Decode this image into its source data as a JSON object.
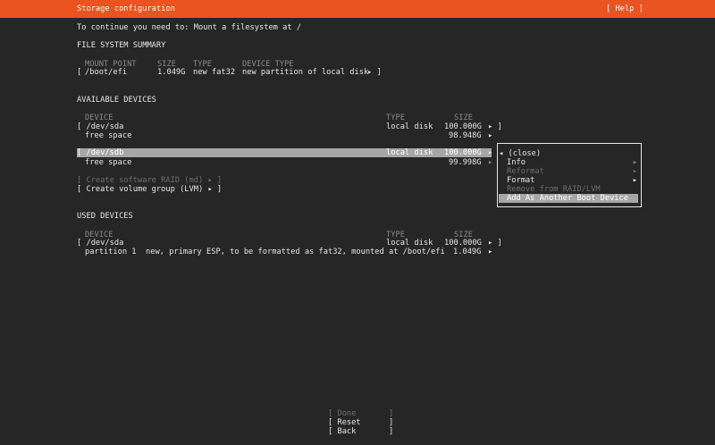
{
  "header": {
    "title": "Storage configuration",
    "help": "[ Help ]"
  },
  "prompt": "To continue you need to: Mount a filesystem at /",
  "fs_summary": {
    "heading": "FILE SYSTEM SUMMARY",
    "columns": [
      "MOUNT POINT",
      "SIZE",
      "TYPE",
      "DEVICE TYPE"
    ],
    "row": {
      "bracket": "[",
      "mount": "/boot/efi",
      "size": "1.049G",
      "type": "new fat32",
      "device_type": "new partition of local disk",
      "arrow": "▸ ]"
    }
  },
  "available": {
    "heading": "AVAILABLE DEVICES",
    "columns": {
      "device": "DEVICE",
      "type": "TYPE",
      "size": "SIZE"
    },
    "sda": {
      "name": "[ /dev/sda",
      "type": "local disk",
      "size": "100.000G",
      "arrow": "▸ ]",
      "free_label": "free space",
      "free_size": "98.948G",
      "free_arrow": "▸"
    },
    "sdb": {
      "name": "[ /dev/sdb",
      "type": "local disk",
      "size": "100.000G",
      "arrow": "▸",
      "free_label": "free space",
      "free_size": "99.998G",
      "free_arrow": "▸"
    },
    "raid": "[ Create software RAID (md) ▸ ]",
    "lvm": "[ Create volume group (LVM) ▸ ]"
  },
  "context_menu": {
    "close": "◂ (close)",
    "items": [
      {
        "label": "Info",
        "arrow": "▸",
        "enabled": true
      },
      {
        "label": "Reformat",
        "arrow": "▸",
        "enabled": false
      },
      {
        "label": "Format",
        "arrow": "▸",
        "enabled": true
      },
      {
        "label": "Remove from RAID/LVM",
        "arrow": "",
        "enabled": false
      },
      {
        "label": "Add As Another Boot Device",
        "arrow": "",
        "enabled": true,
        "selected": true
      }
    ]
  },
  "used": {
    "heading": "USED DEVICES",
    "columns": {
      "device": "DEVICE",
      "type": "TYPE",
      "size": "SIZE"
    },
    "sda": {
      "name": "[ /dev/sda",
      "type": "local disk",
      "size": "100.000G",
      "arrow": "▸ ]"
    },
    "partition": {
      "label": "partition 1  new, primary ESP, to be formatted as fat32, mounted at /boot/efi",
      "size": "1.049G",
      "arrow": "▸"
    }
  },
  "buttons": {
    "done": "[ Done       ]",
    "reset": "[ Reset      ]",
    "back": "[ Back       ]"
  }
}
